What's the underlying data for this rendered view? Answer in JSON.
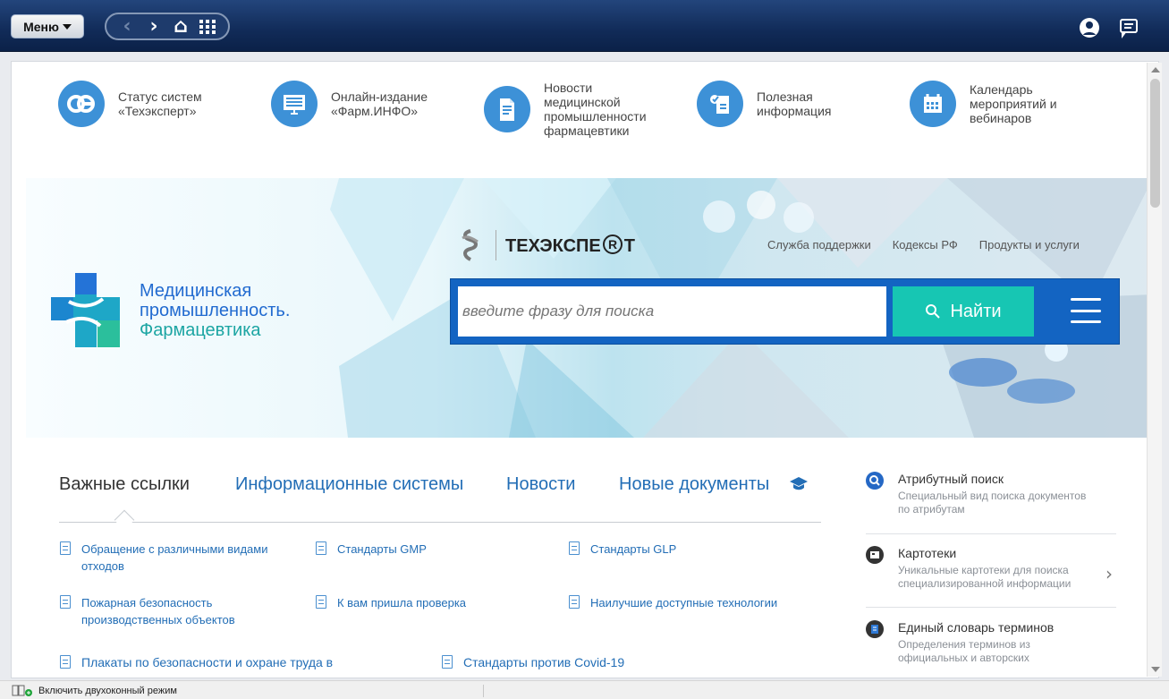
{
  "toolbar": {
    "menu_label": "Меню"
  },
  "top_icons": [
    {
      "label": "Статус систем «Техэксперт»"
    },
    {
      "label": "Онлайн-издание «Фарм.ИНФО»"
    },
    {
      "label": "Новости медицинской промышленности фармацевтики"
    },
    {
      "label": "Полезная информация"
    },
    {
      "label": "Календарь мероприятий и вебинаров"
    }
  ],
  "brand": {
    "name_part1": "ТЕХЭКСПЕ",
    "name_part2": "Т",
    "links": [
      "Служба поддержки",
      "Кодексы РФ",
      "Продукты и услуги"
    ]
  },
  "logo": {
    "line1": "Медицинская",
    "line2": "промышленность.",
    "line3": "Фармацевтика"
  },
  "search": {
    "placeholder": "введите фразу для поиска",
    "button": "Найти"
  },
  "tabs": {
    "items": [
      "Важные ссылки",
      "Информационные системы",
      "Новости",
      "Новые документы"
    ],
    "active": "Важные ссылки"
  },
  "links": [
    {
      "text": "Обращение с различными видами отходов"
    },
    {
      "text": "Стандарты GMP"
    },
    {
      "text": "Стандарты GLP"
    },
    {
      "text": "Пожарная безопасность производственных объектов"
    },
    {
      "text": "К вам пришла проверка"
    },
    {
      "text": "Наилучшие доступные технологии"
    },
    {
      "text": "Плакаты по безопасности и охране труда в"
    },
    {
      "text": "Стандарты против Covid-19"
    }
  ],
  "side": [
    {
      "title": "Атрибутный поиск",
      "desc": "Специальный вид поиска документов по атрибутам"
    },
    {
      "title": "Картотеки",
      "desc": "Уникальные картотеки для поиска специализированной информации"
    },
    {
      "title": "Единый словарь терминов",
      "desc": "Определения терминов из официальных и авторских"
    }
  ],
  "status": {
    "dual_mode": "Включить двухоконный режим"
  },
  "colors": {
    "top_bar": "#112b58",
    "accent_blue": "#3d91d7",
    "link_blue": "#236eb6",
    "search_blue": "#1364c2",
    "button_teal": "#17c6b3",
    "arrow_red": "#e00000"
  }
}
